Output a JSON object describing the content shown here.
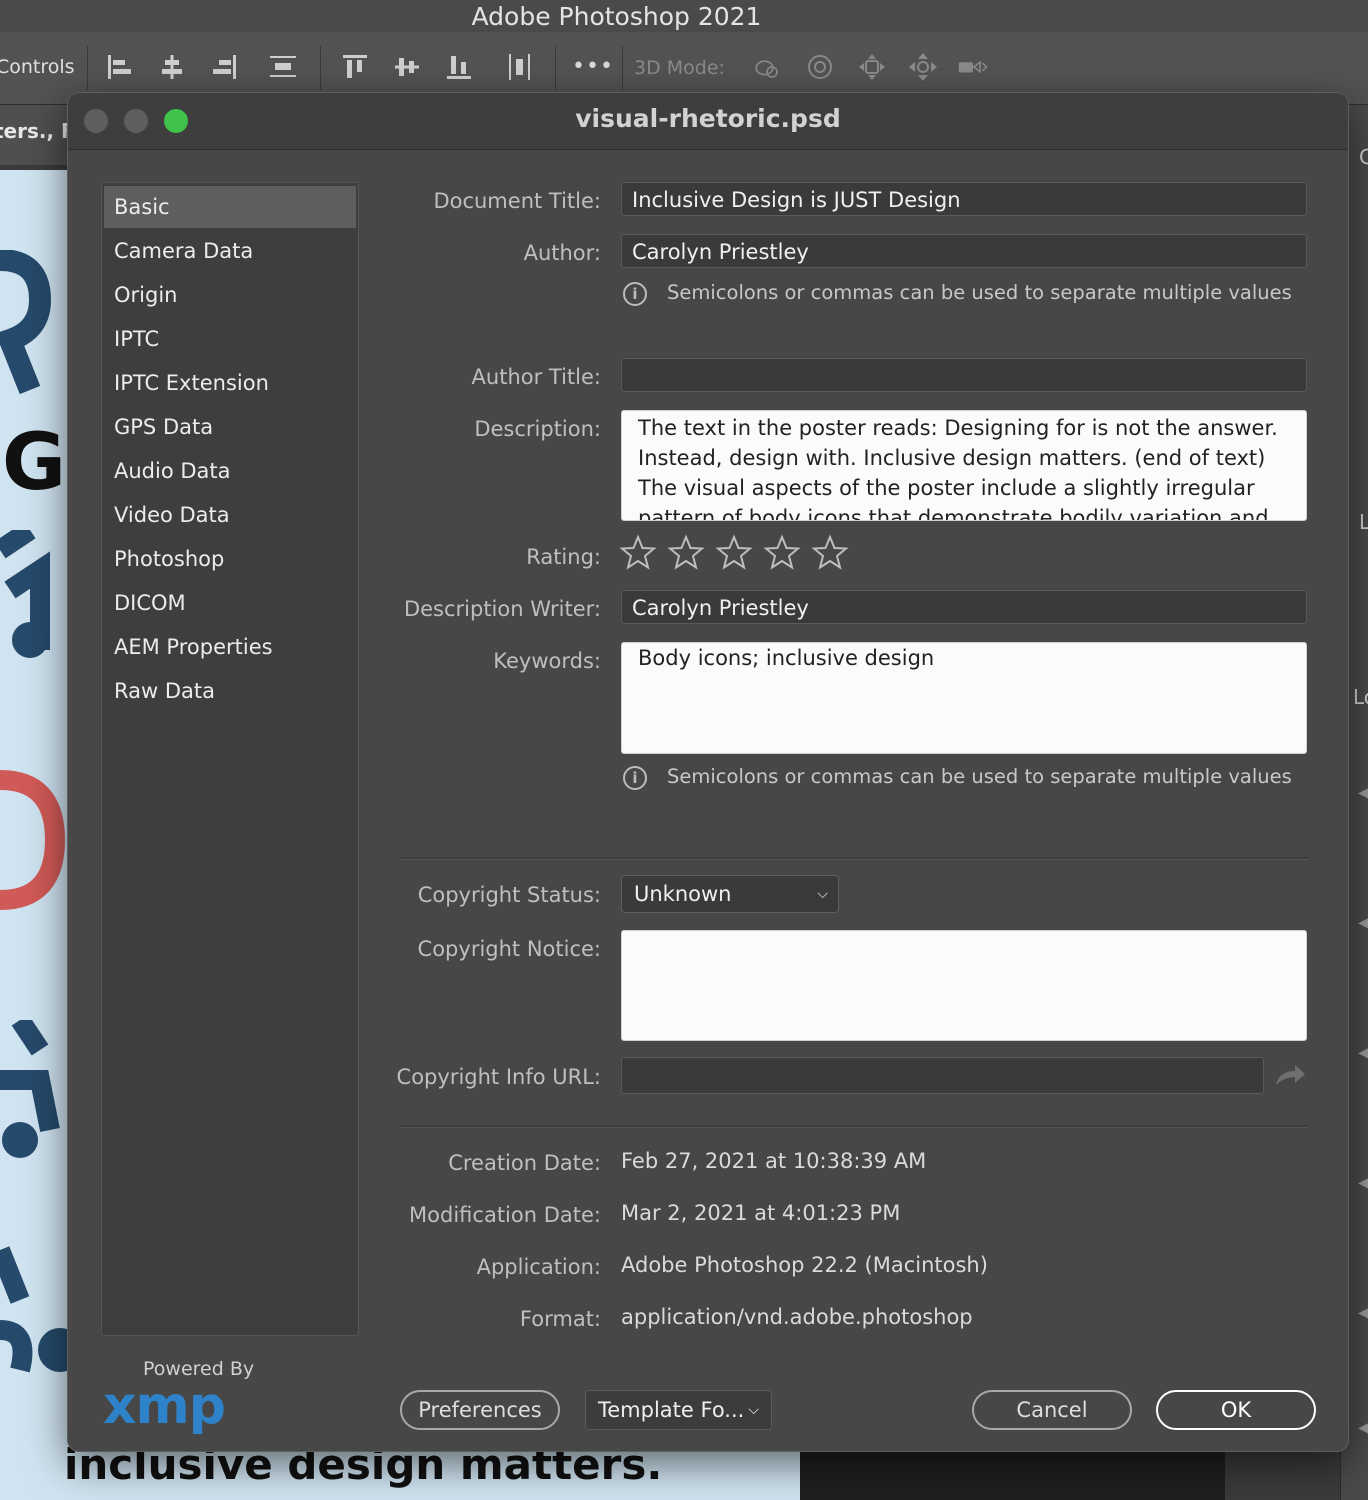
{
  "app": {
    "title": "Adobe Photoshop 2021"
  },
  "options_bar": {
    "controls_label": "Controls",
    "more_label": "•••",
    "mode_3d_label": "3D Mode:"
  },
  "document_tab": {
    "label": "ters., F"
  },
  "poster": {
    "caption": "inclusive design matters.",
    "letter": "G"
  },
  "dialog": {
    "title": "visual-rhetoric.psd",
    "sidebar": {
      "items": [
        {
          "label": "Basic"
        },
        {
          "label": "Camera Data"
        },
        {
          "label": "Origin"
        },
        {
          "label": "IPTC"
        },
        {
          "label": "IPTC Extension"
        },
        {
          "label": "GPS Data"
        },
        {
          "label": "Audio Data"
        },
        {
          "label": "Video Data"
        },
        {
          "label": "Photoshop"
        },
        {
          "label": "DICOM"
        },
        {
          "label": "AEM Properties"
        },
        {
          "label": "Raw Data"
        }
      ],
      "active_index": 0
    },
    "powered_by": "Powered By",
    "xmp_logo": "xmp",
    "fields": {
      "document_title": {
        "label": "Document Title:",
        "value": "Inclusive Design is JUST Design"
      },
      "author": {
        "label": "Author:",
        "value": "Carolyn Priestley"
      },
      "author_hint": "Semicolons or commas can be used to separate multiple values",
      "author_title": {
        "label": "Author Title:",
        "value": ""
      },
      "description": {
        "label": "Description:",
        "value": "The text in the poster reads: Designing for is not the answer. Instead, design with. Inclusive design matters. (end of text) The visual aspects of the poster include a slightly irregular pattern of body icons that demonstrate bodily variation and differing ability."
      },
      "rating": {
        "label": "Rating:",
        "value": 0,
        "max": 5
      },
      "description_writer": {
        "label": "Description Writer:",
        "value": "Carolyn Priestley"
      },
      "keywords": {
        "label": "Keywords:",
        "value": "Body icons; inclusive design"
      },
      "keywords_hint": "Semicolons or commas can be used to separate multiple values",
      "copyright_status": {
        "label": "Copyright Status:",
        "value": "Unknown"
      },
      "copyright_notice": {
        "label": "Copyright Notice:",
        "value": ""
      },
      "copyright_url": {
        "label": "Copyright Info URL:",
        "value": ""
      },
      "creation_date": {
        "label": "Creation Date:",
        "value": "Feb 27, 2021 at 10:38:39 AM"
      },
      "modification_date": {
        "label": "Modification Date:",
        "value": "Mar 2, 2021 at 4:01:23 PM"
      },
      "application": {
        "label": "Application:",
        "value": "Adobe Photoshop 22.2 (Macintosh)"
      },
      "format": {
        "label": "Format:",
        "value": "application/vnd.adobe.photoshop"
      }
    },
    "buttons": {
      "preferences": "Preferences",
      "template": "Template Fo...",
      "cancel": "Cancel",
      "ok": "OK"
    }
  },
  "colors": {
    "accent_blue": "#2e82c9",
    "close": "#5f5f5f",
    "minimize": "#5f5f5f",
    "zoom": "#3fc24a"
  }
}
